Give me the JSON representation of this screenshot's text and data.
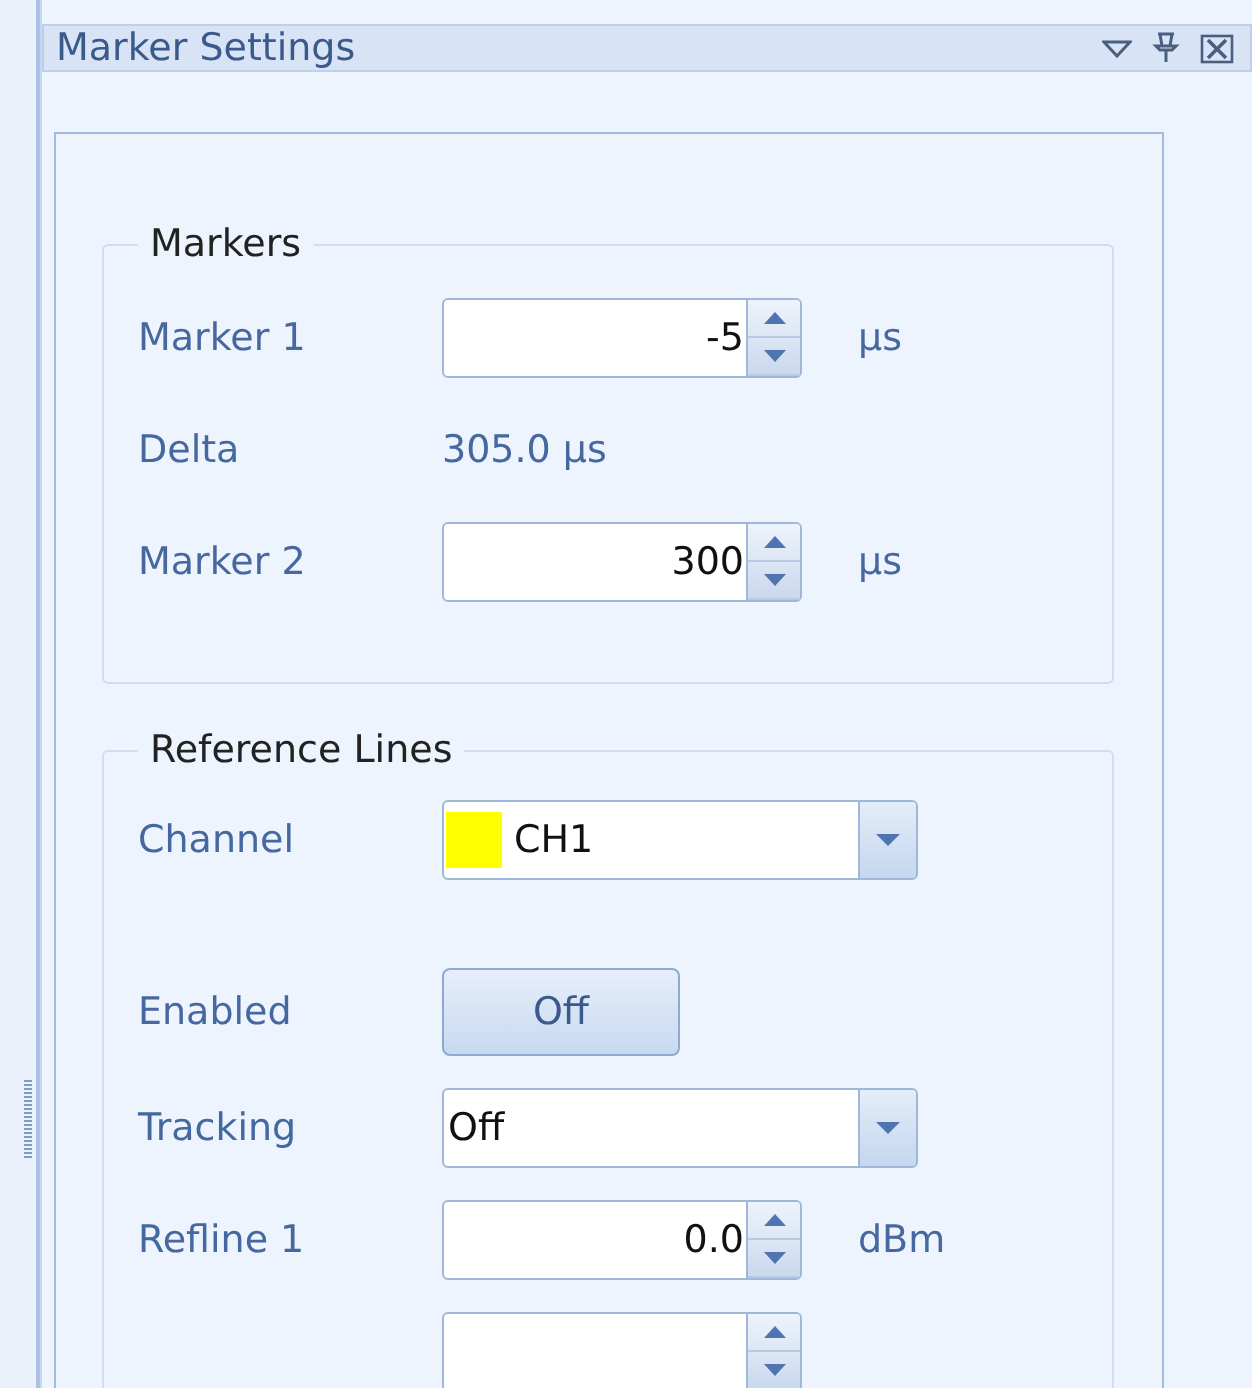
{
  "panel": {
    "title": "Marker Settings"
  },
  "markers": {
    "title": "Markers",
    "rows": [
      {
        "kind": "spinner",
        "label": "Marker 1",
        "value": "-5",
        "unit": "µs"
      },
      {
        "kind": "reading",
        "label": "Delta",
        "value": "305.0 µs"
      },
      {
        "kind": "spinner",
        "label": "Marker 2",
        "value": "300",
        "unit": "µs"
      }
    ]
  },
  "reference_lines": {
    "title": "Reference Lines",
    "rows": [
      {
        "kind": "combo",
        "label": "Channel",
        "value": "CH1",
        "color": "#ffff00"
      },
      {
        "kind": "toggle",
        "label": "Enabled",
        "value": "Off"
      },
      {
        "kind": "combo",
        "label": "Tracking",
        "value": "Off"
      },
      {
        "kind": "spinner",
        "label": "Refline 1",
        "value": "0.0",
        "unit": "dBm"
      },
      {
        "kind": "spinner"
      }
    ]
  }
}
